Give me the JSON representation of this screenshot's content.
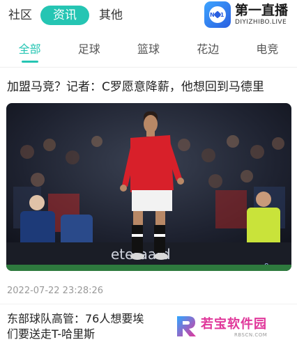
{
  "header": {
    "nav": [
      "社区",
      "资讯",
      "其他"
    ],
    "logo_title": "第一直播",
    "logo_domain": "DIYIZHIBO.LIVE",
    "logo_badge_text": "NO.1",
    "accent": "#25c5b3"
  },
  "tabs": [
    "全部",
    "足球",
    "篮球",
    "花边",
    "电竞"
  ],
  "articles": [
    {
      "title": "加盟马竞？记者：C罗愿意降薪，他想回到马德里",
      "time": "2022-07-22 23:28:26",
      "image_text": {
        "board": "eteraard",
        "corner": "8"
      }
    },
    {
      "title": "东部球队高管：76人想要埃\n们要送走T-哈里斯"
    }
  ],
  "watermark": {
    "title": "若宝软件园",
    "domain": "RBSCN.COM"
  }
}
